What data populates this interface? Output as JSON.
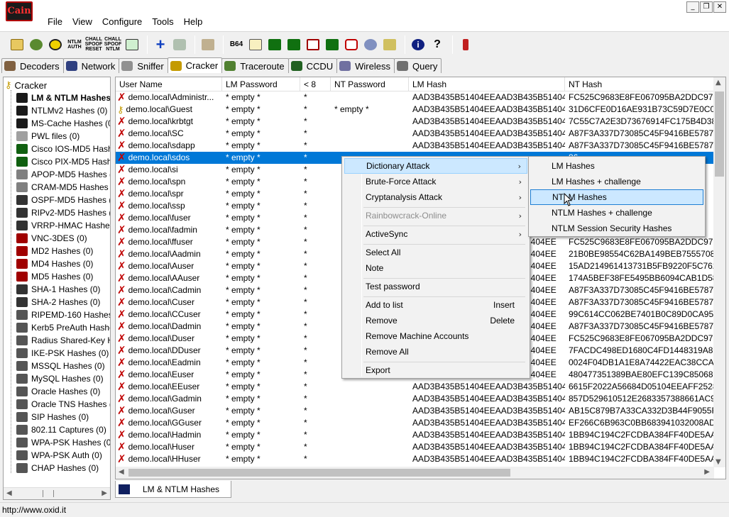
{
  "window": {
    "logo_text": "Cain",
    "controls": [
      "_",
      "❐",
      "✕"
    ]
  },
  "menu": [
    "File",
    "View",
    "Configure",
    "Tools",
    "Help"
  ],
  "toolbar": {
    "icons": [
      "open-icon",
      "nuke-icon",
      "radiation-icon",
      "ntlm-auth-icon",
      "chall-spoof-reset-icon",
      "chall-spoof-ntlm-icon",
      "monitor-icon",
      "add-icon",
      "delete-icon",
      "filter-icon",
      "b64-icon",
      "edit-icon",
      "dict-icon",
      "brute-icon",
      "crypt-icon",
      "rainbow-icon",
      "calc-icon",
      "network-icon",
      "globe-icon",
      "key-icon",
      "info-icon",
      "help-icon",
      "exit-icon"
    ],
    "ntlm_auth_label": "NTLM AUTH",
    "chall_reset_label": "CHALL SPOOF RESET",
    "chall_ntlm_label": "CHALL SPOOF NTLM",
    "b64_label": "B64"
  },
  "tabs": [
    {
      "label": "Decoders",
      "icon": "decoders-icon"
    },
    {
      "label": "Network",
      "icon": "network-icon"
    },
    {
      "label": "Sniffer",
      "icon": "sniffer-icon"
    },
    {
      "label": "Cracker",
      "icon": "cracker-icon",
      "active": true
    },
    {
      "label": "Traceroute",
      "icon": "traceroute-icon"
    },
    {
      "label": "CCDU",
      "icon": "ccdu-icon"
    },
    {
      "label": "Wireless",
      "icon": "wireless-icon"
    },
    {
      "label": "Query",
      "icon": "query-icon"
    }
  ],
  "tree": {
    "root": "Cracker",
    "items": [
      {
        "label": "LM & NTLM Hashes",
        "selected": true
      },
      {
        "label": "NTLMv2 Hashes (0)"
      },
      {
        "label": "MS-Cache Hashes (0"
      },
      {
        "label": "PWL files (0)"
      },
      {
        "label": "Cisco IOS-MD5 Hash"
      },
      {
        "label": "Cisco PIX-MD5 Hash"
      },
      {
        "label": "APOP-MD5 Hashes ("
      },
      {
        "label": "CRAM-MD5 Hashes ("
      },
      {
        "label": "OSPF-MD5 Hashes (0"
      },
      {
        "label": "RIPv2-MD5 Hashes (0"
      },
      {
        "label": "VRRP-HMAC Hashes"
      },
      {
        "label": "VNC-3DES (0)"
      },
      {
        "label": "MD2 Hashes (0)"
      },
      {
        "label": "MD4 Hashes (0)"
      },
      {
        "label": "MD5 Hashes (0)"
      },
      {
        "label": "SHA-1 Hashes (0)"
      },
      {
        "label": "SHA-2 Hashes (0)"
      },
      {
        "label": "RIPEMD-160 Hashes"
      },
      {
        "label": "Kerb5 PreAuth Hashe"
      },
      {
        "label": "Radius Shared-Key H"
      },
      {
        "label": "IKE-PSK Hashes (0)"
      },
      {
        "label": "MSSQL Hashes (0)"
      },
      {
        "label": "MySQL Hashes (0)"
      },
      {
        "label": "Oracle Hashes (0)"
      },
      {
        "label": "Oracle TNS Hashes (("
      },
      {
        "label": "SIP Hashes (0)"
      },
      {
        "label": "802.11 Captures (0)"
      },
      {
        "label": "WPA-PSK Hashes (0)"
      },
      {
        "label": "WPA-PSK Auth (0)"
      },
      {
        "label": "CHAP Hashes (0)"
      }
    ]
  },
  "table": {
    "columns": [
      "User Name",
      "LM Password",
      "< 8",
      "NT Password",
      "LM Hash",
      "NT Hash"
    ],
    "rows": [
      {
        "user": "demo.local\\Administr...",
        "lm_pw": "* empty *",
        "lt8": "*",
        "nt_pw": "",
        "lm_hash": "AAD3B435B51404EEAAD3B435B51404EE",
        "nt_hash": "FC525C9683E8FE067095BA2DDC971889",
        "mark": "x"
      },
      {
        "user": "demo.local\\Guest",
        "lm_pw": "* empty *",
        "lt8": "*",
        "nt_pw": "* empty *",
        "lm_hash": "AAD3B435B51404EEAAD3B435B51404EE",
        "nt_hash": "31D6CFE0D16AE931B73C59D7E0C089C0",
        "mark": "key"
      },
      {
        "user": "demo.local\\krbtgt",
        "lm_pw": "* empty *",
        "lt8": "*",
        "nt_pw": "",
        "lm_hash": "AAD3B435B51404EEAAD3B435B51404EE",
        "nt_hash": "7C55C7A2E3D73676914FC175B4D384C1",
        "mark": "x"
      },
      {
        "user": "demo.local\\SC",
        "lm_pw": "* empty *",
        "lt8": "*",
        "nt_pw": "",
        "lm_hash": "AAD3B435B51404EEAAD3B435B51404EE",
        "nt_hash": "A87F3A337D73085C45F9416BE5787D86",
        "mark": "x"
      },
      {
        "user": "demo.local\\sdapp",
        "lm_pw": "* empty *",
        "lt8": "*",
        "nt_pw": "",
        "lm_hash": "AAD3B435B51404EEAAD3B435B51404EE",
        "nt_hash": "A87F3A337D73085C45F9416BE5787D86",
        "mark": "x"
      },
      {
        "user": "demo.local\\sdos",
        "lm_pw": "* empty *",
        "lt8": "*",
        "nt_pw": "",
        "lm_hash": "",
        "nt_hash": "86",
        "mark": "x",
        "selected": true
      },
      {
        "user": "demo.local\\si",
        "lm_pw": "* empty *",
        "lt8": "*",
        "nt_pw": "",
        "lm_hash": "",
        "nt_hash": "",
        "mark": "x"
      },
      {
        "user": "demo.local\\spn",
        "lm_pw": "* empty *",
        "lt8": "*",
        "nt_pw": "",
        "lm_hash": "",
        "nt_hash": "",
        "mark": "x"
      },
      {
        "user": "demo.local\\spr",
        "lm_pw": "* empty *",
        "lt8": "*",
        "nt_pw": "",
        "lm_hash": "",
        "nt_hash": "",
        "mark": "x"
      },
      {
        "user": "demo.local\\ssp",
        "lm_pw": "* empty *",
        "lt8": "*",
        "nt_pw": "",
        "lm_hash": "",
        "nt_hash": "",
        "mark": "x"
      },
      {
        "user": "demo.local\\fuser",
        "lm_pw": "* empty *",
        "lt8": "*",
        "nt_pw": "",
        "lm_hash": "",
        "nt_hash": "",
        "mark": "x"
      },
      {
        "user": "demo.local\\fadmin",
        "lm_pw": "* empty *",
        "lt8": "*",
        "nt_pw": "",
        "lm_hash": "",
        "nt_hash": "",
        "mark": "x"
      },
      {
        "user": "demo.local\\ffuser",
        "lm_pw": "* empty *",
        "lt8": "*",
        "nt_pw": "",
        "lm_hash": "1404EE",
        "nt_hash": "FC525C9683E8FE067095BA2DDC971889",
        "mark": "x"
      },
      {
        "user": "demo.local\\Aadmin",
        "lm_pw": "* empty *",
        "lt8": "*",
        "nt_pw": "",
        "lm_hash": "1404EE",
        "nt_hash": "21B0BE98554C62BA149BEB75557084BE",
        "mark": "x"
      },
      {
        "user": "demo.local\\Auser",
        "lm_pw": "* empty *",
        "lt8": "*",
        "nt_pw": "",
        "lm_hash": "1404EE",
        "nt_hash": "15AD214961413731B5FB9220F5C76246",
        "mark": "x"
      },
      {
        "user": "demo.local\\AAuser",
        "lm_pw": "* empty *",
        "lt8": "*",
        "nt_pw": "",
        "lm_hash": "1404EE",
        "nt_hash": "174A5BEF38FE5495BB6094CAB1D5812E",
        "mark": "x"
      },
      {
        "user": "demo.local\\Cadmin",
        "lm_pw": "* empty *",
        "lt8": "*",
        "nt_pw": "",
        "lm_hash": "1404EE",
        "nt_hash": "A87F3A337D73085C45F9416BE5787D86",
        "mark": "x"
      },
      {
        "user": "demo.local\\Cuser",
        "lm_pw": "* empty *",
        "lt8": "*",
        "nt_pw": "",
        "lm_hash": "1404EE",
        "nt_hash": "A87F3A337D73085C45F9416BE5787D86",
        "mark": "x"
      },
      {
        "user": "demo.local\\CCuser",
        "lm_pw": "* empty *",
        "lt8": "*",
        "nt_pw": "",
        "lm_hash": "1404EE",
        "nt_hash": "99C614CC062BE7401B0C89D0CA9504D",
        "mark": "x"
      },
      {
        "user": "demo.local\\Dadmin",
        "lm_pw": "* empty *",
        "lt8": "*",
        "nt_pw": "",
        "lm_hash": "1404EE",
        "nt_hash": "A87F3A337D73085C45F9416BE5787D86",
        "mark": "x"
      },
      {
        "user": "demo.local\\Duser",
        "lm_pw": "* empty *",
        "lt8": "*",
        "nt_pw": "",
        "lm_hash": "1404EE",
        "nt_hash": "FC525C9683E8FE067095BA2DDC971889",
        "mark": "x"
      },
      {
        "user": "demo.local\\DDuser",
        "lm_pw": "* empty *",
        "lt8": "*",
        "nt_pw": "",
        "lm_hash": "1404EE",
        "nt_hash": "7FACDC498ED1680C4FD1448319A8C04",
        "mark": "x"
      },
      {
        "user": "demo.local\\Eadmin",
        "lm_pw": "* empty *",
        "lt8": "*",
        "nt_pw": "",
        "lm_hash": "1404EE",
        "nt_hash": "0024F04DB1A1E8A74422EAC38CCA6E6",
        "mark": "x"
      },
      {
        "user": "demo.local\\Euser",
        "lm_pw": "* empty *",
        "lt8": "*",
        "nt_pw": "",
        "lm_hash": "1404EE",
        "nt_hash": "480477351389BAE80EFC139C85068827",
        "mark": "x"
      },
      {
        "user": "demo.local\\EEuser",
        "lm_pw": "* empty *",
        "lt8": "*",
        "nt_pw": "",
        "lm_hash": "AAD3B435B51404EEAAD3B435B51404EE",
        "nt_hash": "6615F2022A56684D05104EEAFF2528F9",
        "mark": "x"
      },
      {
        "user": "demo.local\\Gadmin",
        "lm_pw": "* empty *",
        "lt8": "*",
        "nt_pw": "",
        "lm_hash": "AAD3B435B51404EEAAD3B435B51404EE",
        "nt_hash": "857D529610512E2683357388661AC958",
        "mark": "x"
      },
      {
        "user": "demo.local\\Guser",
        "lm_pw": "* empty *",
        "lt8": "*",
        "nt_pw": "",
        "lm_hash": "AAD3B435B51404EEAAD3B435B51404EE",
        "nt_hash": "AB15C879B7A33CA332D3B44F9055F80A",
        "mark": "x"
      },
      {
        "user": "demo.local\\GGuser",
        "lm_pw": "* empty *",
        "lt8": "*",
        "nt_pw": "",
        "lm_hash": "AAD3B435B51404EEAAD3B435B51404EE",
        "nt_hash": "EF266C6B963C0BB683941032008AD47F",
        "mark": "x"
      },
      {
        "user": "demo.local\\Hadmin",
        "lm_pw": "* empty *",
        "lt8": "*",
        "nt_pw": "",
        "lm_hash": "AAD3B435B51404EEAAD3B435B51404EE",
        "nt_hash": "1BB94C194C2FCDBA384FF40DE5AAFB1",
        "mark": "x"
      },
      {
        "user": "demo.local\\Huser",
        "lm_pw": "* empty *",
        "lt8": "*",
        "nt_pw": "",
        "lm_hash": "AAD3B435B51404EEAAD3B435B51404EE",
        "nt_hash": "1BB94C194C2FCDBA384FF40DE5AAFB1",
        "mark": "x"
      },
      {
        "user": "demo.local\\HHuser",
        "lm_pw": "* empty *",
        "lt8": "*",
        "nt_pw": "",
        "lm_hash": "AAD3B435B51404EEAAD3B435B51404EE",
        "nt_hash": "1BB94C194C2FCDBA384FF40DE5AAFB1",
        "mark": "x"
      }
    ]
  },
  "context_menu": {
    "items": [
      {
        "label": "Dictionary Attack",
        "arrow": true,
        "highlighted": true
      },
      {
        "label": "Brute-Force Attack",
        "arrow": true
      },
      {
        "label": "Cryptanalysis Attack",
        "arrow": true
      },
      {
        "sep": true
      },
      {
        "label": "Rainbowcrack-Online",
        "arrow": true,
        "disabled": true
      },
      {
        "sep": true
      },
      {
        "label": "ActiveSync",
        "arrow": true
      },
      {
        "sep": true
      },
      {
        "label": "Select All"
      },
      {
        "label": "Note"
      },
      {
        "sep": true
      },
      {
        "label": "Test password"
      },
      {
        "sep": true
      },
      {
        "label": "Add to list",
        "shortcut": "Insert"
      },
      {
        "label": "Remove",
        "shortcut": "Delete"
      },
      {
        "label": "Remove Machine Accounts"
      },
      {
        "label": "Remove All"
      },
      {
        "sep": true
      },
      {
        "label": "Export"
      }
    ]
  },
  "submenu": {
    "items": [
      {
        "label": "LM Hashes"
      },
      {
        "label": "LM Hashes + challenge"
      },
      {
        "label": "NTLM Hashes",
        "highlighted": true
      },
      {
        "label": "NTLM Hashes + challenge"
      },
      {
        "label": "NTLM Session Security Hashes"
      }
    ]
  },
  "doc_tab": {
    "label": "LM & NTLM Hashes"
  },
  "status": {
    "text": "http://www.oxid.it"
  },
  "colors": {
    "selection": "#0078d7",
    "menu_highlight": "#cce8ff",
    "x_mark": "#c00000"
  }
}
